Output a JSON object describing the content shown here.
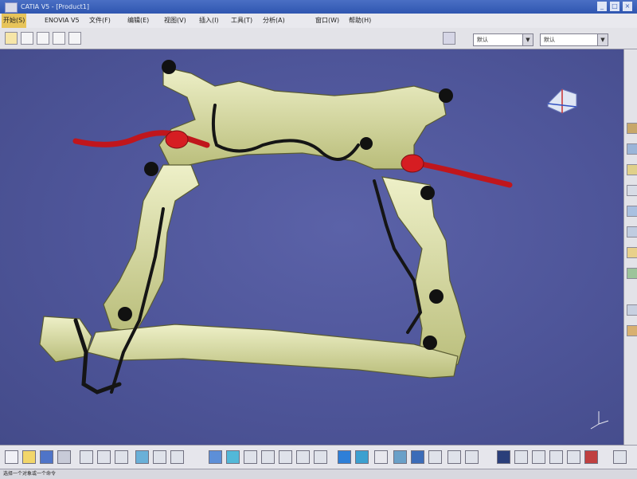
{
  "window": {
    "title": "CATIA V5 - [Product1]",
    "buttons": {
      "minimize": "_",
      "maximize": "□",
      "close": "×"
    }
  },
  "menubar": {
    "items": [
      "开始(S)",
      "ENOVIA V5",
      "文件(F)",
      "编辑(E)",
      "视图(V)",
      "插入(I)",
      "工具(T)",
      "分析(A)",
      "窗口(W)",
      "帮助(H)"
    ]
  },
  "toolbar": {
    "combo1": "默认",
    "combo2": "默认",
    "combo_arrow": "▼"
  },
  "viewport": {
    "background": "#4e5599",
    "model": "front subframe assembly",
    "part_color": "#d9dca0",
    "stabilizer_color": "#c0161c",
    "hose_color": "#151515"
  },
  "icons": {
    "top": [
      "new-icon",
      "open-icon",
      "save-icon",
      "print-icon"
    ],
    "compass": "compass-icon",
    "axis": "axis-triad-icon"
  },
  "status": {
    "text": "选择一个对象或一个命令"
  }
}
